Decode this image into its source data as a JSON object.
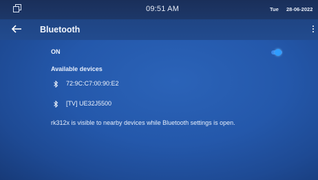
{
  "status_bar": {
    "time": "09:51 AM",
    "day": "Tue",
    "date": "28-06-2022",
    "left_icon": "screen-mirror-icon"
  },
  "app_bar": {
    "back_icon": "arrow-left-icon",
    "title": "Bluetooth",
    "menu_icon": "more-vert-icon"
  },
  "bluetooth": {
    "state_label": "ON",
    "enabled": true,
    "toggle_color": "#2f9cff",
    "available_devices_title": "Available devices",
    "devices": [
      {
        "icon": "bluetooth-icon",
        "name": "72:9C:C7:00:90:E2"
      },
      {
        "icon": "bluetooth-icon",
        "name": "[TV] UE32J5500"
      }
    ],
    "visibility_note": "rk312x is visible to nearby devices while Bluetooth settings is open."
  },
  "colors": {
    "background": "#2458ab",
    "status_bar": "#1a2f5a",
    "accent": "#2f9cff"
  }
}
